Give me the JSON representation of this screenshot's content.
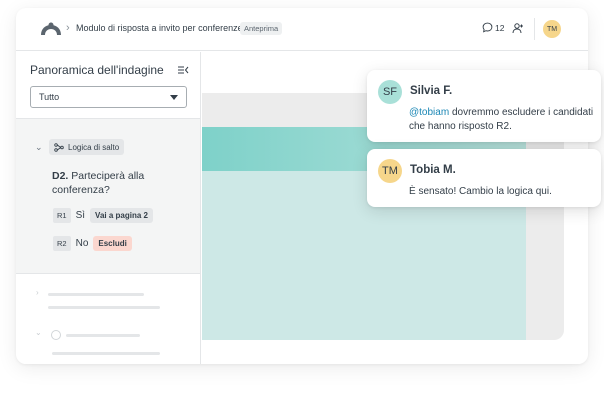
{
  "header": {
    "survey_title": "Modulo di risposta a invito per conferenze",
    "preview_badge": "Anteprima",
    "comment_count": "12",
    "user_initials": "TM"
  },
  "sidebar": {
    "title": "Panoramica dell'indagine",
    "filter_value": "Tutto",
    "logic_label": "Logica di salto",
    "question_number": "D2.",
    "question_text": "Parteciperà alla conferenza?",
    "answers": [
      {
        "code": "R1",
        "label": "Sì",
        "action": "Vai a pagina 2"
      },
      {
        "code": "R2",
        "label": "No",
        "action": "Escludi"
      }
    ]
  },
  "comments": [
    {
      "initials": "SF",
      "name": "Silvia F.",
      "mention": "@tobiam",
      "text": " dovremmo escludere i candidati che hanno risposto R2.",
      "avatar_color": "#a9e0d8"
    },
    {
      "initials": "TM",
      "name": "Tobia M.",
      "mention": "",
      "text": "È sensato! Cambio la logica qui.",
      "avatar_color": "#f6d68b"
    }
  ],
  "colors": {
    "accent_teal": "#7ed1c9",
    "mention": "#1b87b5",
    "exclude_bg": "#fbd7cf"
  }
}
